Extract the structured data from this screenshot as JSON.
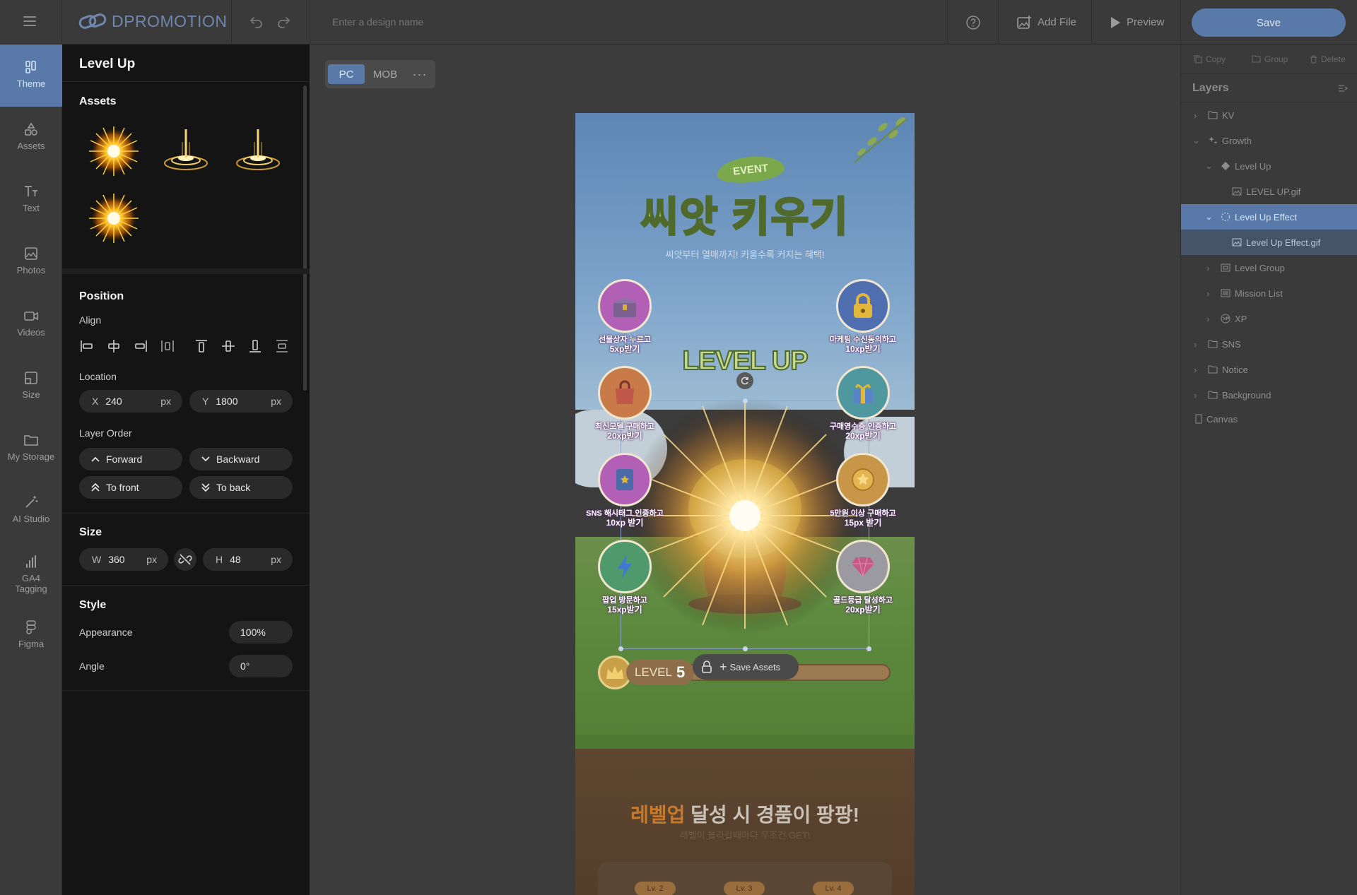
{
  "topbar": {
    "brand": "DPROMOTION",
    "design_name_placeholder": "Enter a design name",
    "add_file": "Add File",
    "preview": "Preview",
    "save": "Save"
  },
  "leftnav": {
    "items": [
      {
        "label": "Theme",
        "icon": "theme-icon"
      },
      {
        "label": "Assets",
        "icon": "shapes-icon"
      },
      {
        "label": "Text",
        "icon": "text-icon"
      },
      {
        "label": "Photos",
        "icon": "photo-icon"
      },
      {
        "label": "Videos",
        "icon": "video-icon"
      },
      {
        "label": "Size",
        "icon": "resize-icon"
      },
      {
        "label": "My Storage",
        "icon": "folder-icon"
      },
      {
        "label": "AI Studio",
        "icon": "magic-wand-icon"
      },
      {
        "label": "GA4\nTagging",
        "icon": "analytics-icon"
      },
      {
        "label": "Figma",
        "icon": "figma-icon"
      }
    ]
  },
  "panel": {
    "title": "Level Up",
    "assets_heading": "Assets",
    "position_heading": "Position",
    "align_label": "Align",
    "location_label": "Location",
    "x_label": "X",
    "x_value": "240",
    "y_label": "Y",
    "y_value": "1800",
    "unit": "px",
    "layer_order_label": "Layer Order",
    "forward": "Forward",
    "backward": "Backward",
    "to_front": "To front",
    "to_back": "To back",
    "size_heading": "Size",
    "w_label": "W",
    "w_value": "360",
    "h_label": "H",
    "h_value": "48",
    "style_heading": "Style",
    "appearance_label": "Appearance",
    "appearance_value": "100%",
    "angle_label": "Angle",
    "angle_value": "0°"
  },
  "canvas": {
    "tab_pc": "PC",
    "tab_mob": "MOB",
    "event_badge": "EVENT",
    "headline": "씨앗 키우기",
    "subtitle": "씨앗부터 열매까지! 키울수록 커지는 혜택!",
    "level_up_text": "LEVEL UP",
    "level_label": "LEVEL",
    "level_number": "5",
    "save_assets": "Save Assets",
    "missions": [
      {
        "line1": "선물상자 누르고",
        "line2": "5xp받기"
      },
      {
        "line1": "마케팅 수신동의하고",
        "line2": "10xp받기"
      },
      {
        "line1": "최신모델 구매하고",
        "line2": "20xp받기"
      },
      {
        "line1": "구매영수증 인증하고",
        "line2": "20xp받기"
      },
      {
        "line1": "SNS 해시태그 인증하고",
        "line2": "10xp 받기"
      },
      {
        "line1": "5만원 이상 구매하고",
        "line2": "15px 받기"
      },
      {
        "line1": "팝업 방문하고",
        "line2": "15xp받기"
      },
      {
        "line1": "골드등급 달성하고",
        "line2": "20xp받기"
      }
    ],
    "prize_highlight": "레벨업",
    "prize_rest": " 달성 시 경품이 팡팡!",
    "prize_sub": "레벨이 올라갈때마다 무조건 GET!",
    "lv_tags": [
      "Lv. 2",
      "Lv. 3",
      "Lv. 4"
    ]
  },
  "rightpanel": {
    "copy": "Copy",
    "group": "Group",
    "delete": "Delete",
    "layers_heading": "Layers",
    "layers": [
      {
        "label": "KV"
      },
      {
        "label": "Growth"
      },
      {
        "label": "Level Up"
      },
      {
        "label": "LEVEL UP.gif"
      },
      {
        "label": "Level Up Effect"
      },
      {
        "label": "Level Up Effect.gif"
      },
      {
        "label": "Level Group"
      },
      {
        "label": "Mission List"
      },
      {
        "label": "XP"
      },
      {
        "label": "SNS"
      },
      {
        "label": "Notice"
      },
      {
        "label": "Background"
      },
      {
        "label": "Canvas"
      }
    ]
  },
  "colors": {
    "accent": "#5979a8",
    "panel_bg": "#141414",
    "chrome_bg": "#3a3a3a"
  }
}
